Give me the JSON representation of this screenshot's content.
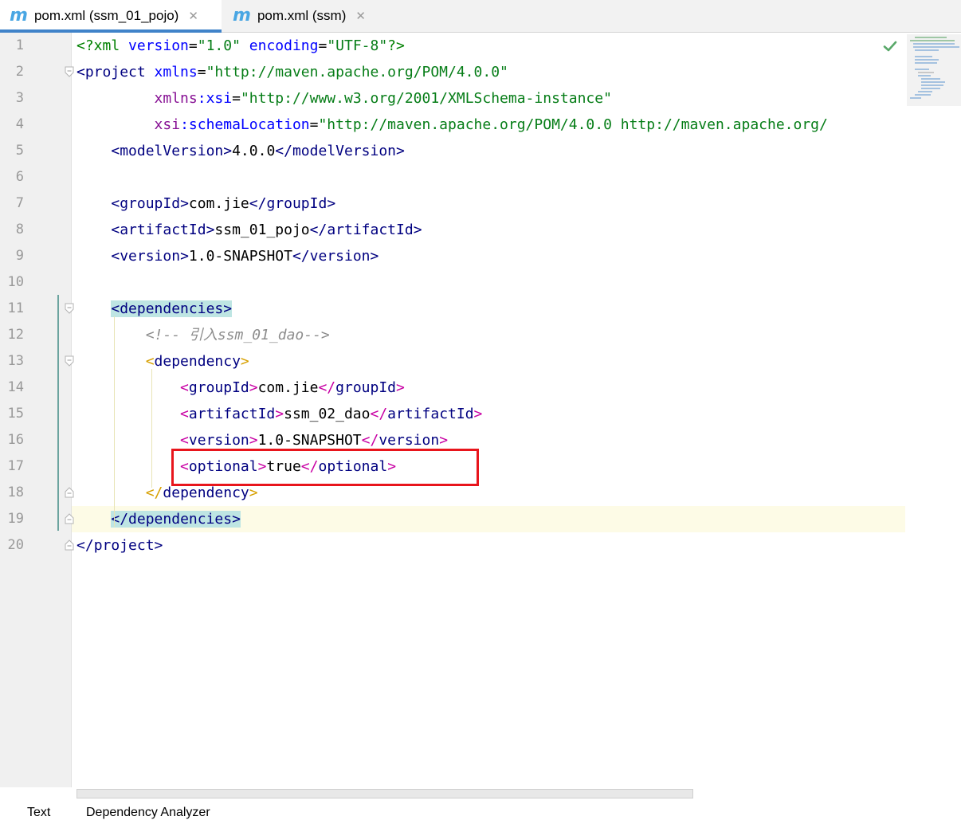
{
  "tabs": [
    {
      "icon": "maven-m-icon",
      "label": "pom.xml (ssm_01_pojo)",
      "active": true
    },
    {
      "icon": "maven-m-icon",
      "label": "pom.xml (ssm)",
      "active": false
    }
  ],
  "editor": {
    "line_numbers": [
      "1",
      "2",
      "3",
      "4",
      "5",
      "6",
      "7",
      "8",
      "9",
      "10",
      "11",
      "12",
      "13",
      "14",
      "15",
      "16",
      "17",
      "18",
      "19",
      "20"
    ],
    "lines": [
      "<?xml version=\"1.0\" encoding=\"UTF-8\"?>",
      "<project xmlns=\"http://maven.apache.org/POM/4.0.0\"",
      "         xmlns:xsi=\"http://www.w3.org/2001/XMLSchema-instance\"",
      "         xsi:schemaLocation=\"http://maven.apache.org/POM/4.0.0 http://maven.apache.org/",
      "    <modelVersion>4.0.0</modelVersion>",
      "",
      "    <groupId>com.jie</groupId>",
      "    <artifactId>ssm_01_pojo</artifactId>",
      "    <version>1.0-SNAPSHOT</version>",
      "",
      "    <dependencies>",
      "        <!-- 引入ssm_01_dao-->",
      "        <dependency>",
      "            <groupId>com.jie</groupId>",
      "            <artifactId>ssm_02_dao</artifactId>",
      "            <version>1.0-SNAPSHOT</version>",
      "            <optional>true</optional>",
      "        </dependency>",
      "    </dependencies>",
      "</project>"
    ],
    "current_line": "19",
    "highlighted_line": "17"
  },
  "status": {
    "inspection_icon": "check-icon"
  },
  "bottom_tabs": [
    "Text",
    "Dependency Analyzer"
  ],
  "colors": {
    "tag": "#000080",
    "attribute": "#0000ff",
    "string": "#067d17",
    "comment": "#8c8c8c",
    "highlight_box": "#e8151c",
    "active_tab_underline": "#4083c9"
  }
}
